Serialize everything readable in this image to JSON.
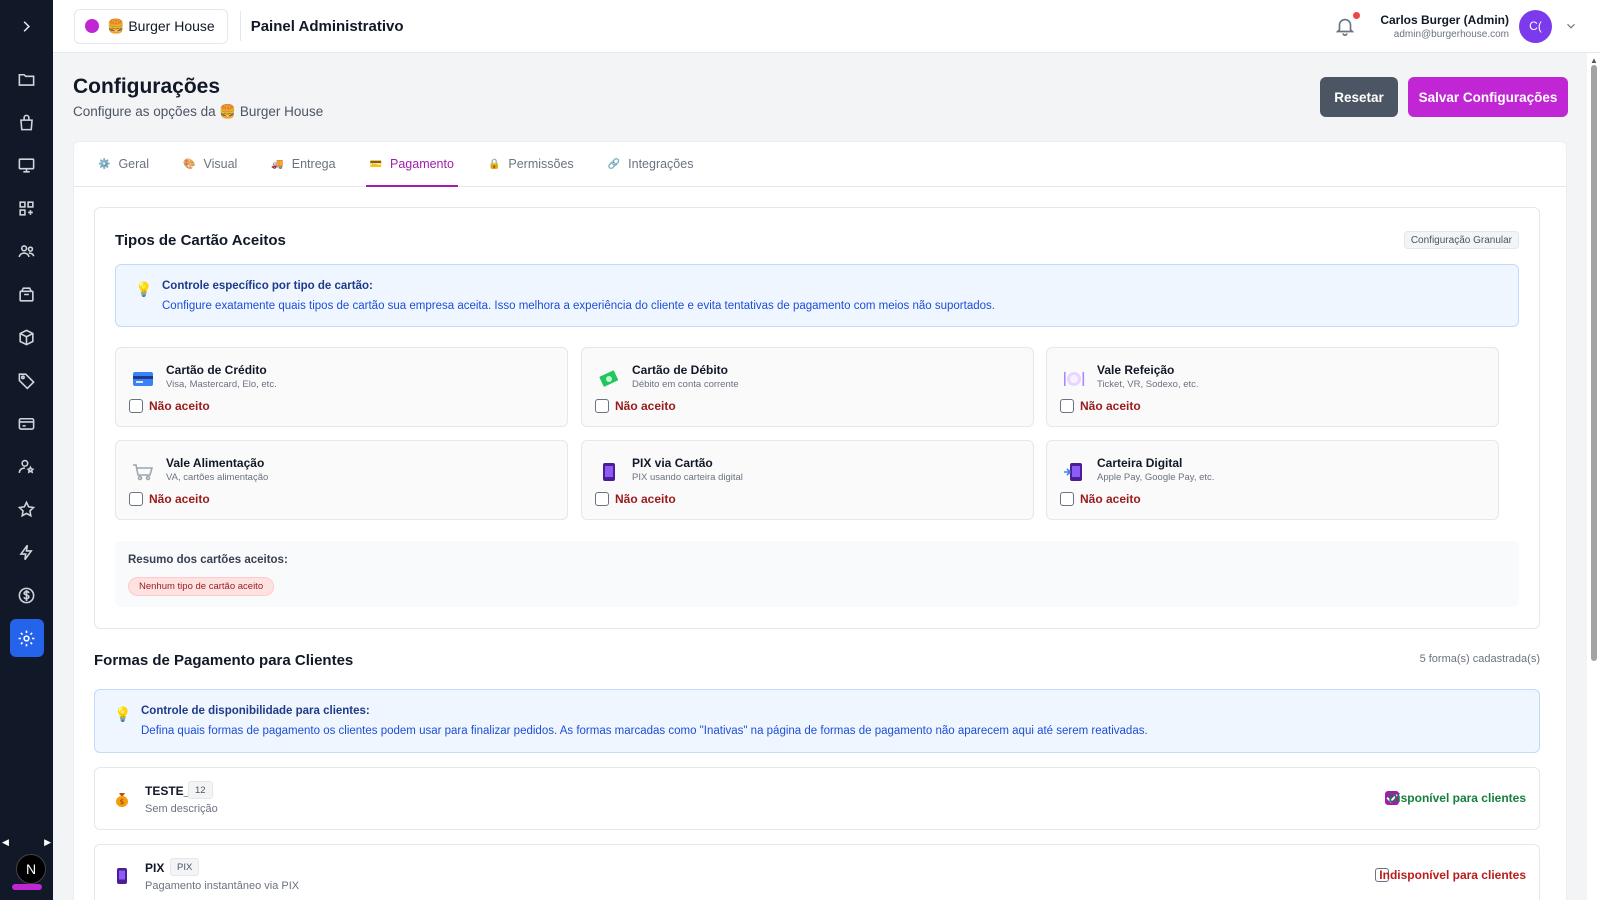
{
  "header": {
    "brand_name": "🍔 Burger House",
    "title": "Painel Administrativo",
    "user_name": "Carlos Burger (Admin)",
    "user_email": "admin@burgerhouse.com",
    "avatar_initials": "C(",
    "brand_color": "#c026d3"
  },
  "sidebar": {
    "items": [
      {
        "icon": "folder-icon"
      },
      {
        "icon": "shopping-bag-icon"
      },
      {
        "icon": "monitor-icon"
      },
      {
        "icon": "grid-add-icon"
      },
      {
        "icon": "users-icon"
      },
      {
        "icon": "archive-icon"
      },
      {
        "icon": "box-icon"
      },
      {
        "icon": "tag-icon"
      },
      {
        "icon": "credit-card-icon"
      },
      {
        "icon": "user-settings-icon"
      },
      {
        "icon": "star-icon"
      },
      {
        "icon": "bolt-icon"
      },
      {
        "icon": "dollar-icon"
      },
      {
        "icon": "gear-icon",
        "active": true
      }
    ],
    "bottom_avatar": "N"
  },
  "page": {
    "title": "Configurações",
    "subtitle": "Configure as opções da 🍔 Burger House",
    "reset_label": "Resetar",
    "save_label": "Salvar Configurações"
  },
  "tabs": [
    {
      "label": "Geral",
      "icon": "⚙️"
    },
    {
      "label": "Visual",
      "icon": "🎨"
    },
    {
      "label": "Entrega",
      "icon": "🚚"
    },
    {
      "label": "Pagamento",
      "icon": "💳",
      "active": true
    },
    {
      "label": "Permissões",
      "icon": "🔒"
    },
    {
      "label": "Integrações",
      "icon": "🔗"
    }
  ],
  "card_types": {
    "title": "Tipos de Cartão Aceitos",
    "badge": "Configuração Granular",
    "info_title": "Controle específico por tipo de cartão:",
    "info_text": "Configure exatamente quais tipos de cartão sua empresa aceita. Isso melhora a experiência do cliente e evita tentativas de pagamento com meios não suportados.",
    "items": [
      {
        "name": "Cartão de Crédito",
        "desc": "Visa, Mastercard, Elo, etc.",
        "status": "Não aceito",
        "icon": "credit-card-icon"
      },
      {
        "name": "Cartão de Débito",
        "desc": "Débito em conta corrente",
        "status": "Não aceito",
        "icon": "money-icon"
      },
      {
        "name": "Vale Refeição",
        "desc": "Ticket, VR, Sodexo, etc.",
        "status": "Não aceito",
        "icon": "plate-icon"
      },
      {
        "name": "Vale Alimentação",
        "desc": "VA, cartões alimentação",
        "status": "Não aceito",
        "icon": "cart-icon"
      },
      {
        "name": "PIX via Cartão",
        "desc": "PIX usando carteira digital",
        "status": "Não aceito",
        "icon": "phone-icon"
      },
      {
        "name": "Carteira Digital",
        "desc": "Apple Pay, Google Pay, etc.",
        "status": "Não aceito",
        "icon": "wallet-phone-icon"
      }
    ],
    "summary_title": "Resumo dos cartões aceitos:",
    "summary_badge": "Nenhum tipo de cartão aceito"
  },
  "payment_methods": {
    "title": "Formas de Pagamento para Clientes",
    "count": "5 forma(s) cadastrada(s)",
    "info_title": "Controle de disponibilidade para clientes:",
    "info_text": "Defina quais formas de pagamento os clientes podem usar para finalizar pedidos. As formas marcadas como \"Inativas\" na página de formas de pagamento não aparecem aqui até serem reativadas.",
    "items": [
      {
        "name": "TESTE_",
        "code": "12",
        "desc": "Sem descrição",
        "status": "Disponível para clientes",
        "checked": true,
        "icon": "money-bag-icon"
      },
      {
        "name": "PIX",
        "code": "PIX",
        "desc": "Pagamento instantâneo via PIX",
        "status": "Indisponível para clientes",
        "checked": false,
        "icon": "phone-icon"
      }
    ]
  }
}
